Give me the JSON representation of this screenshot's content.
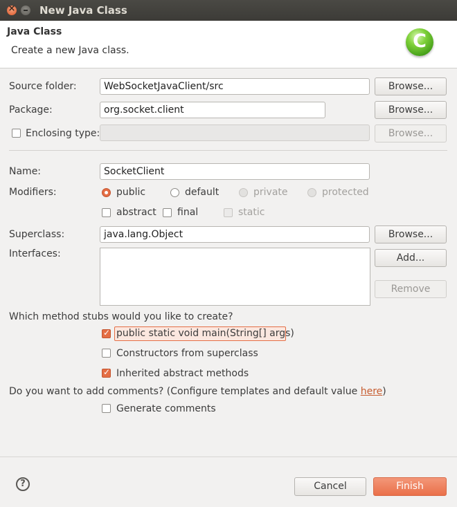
{
  "window": {
    "title": "New Java Class"
  },
  "header": {
    "title": "Java Class",
    "description": "Create a new Java class.",
    "logo_icon": "java-class-c-icon",
    "logo_letter": "C"
  },
  "form": {
    "source_folder": {
      "label": "Source folder:",
      "value": "WebSocketJavaClient/src",
      "browse": "Browse..."
    },
    "package": {
      "label": "Package:",
      "value": "org.socket.client",
      "browse": "Browse..."
    },
    "enclosing_type": {
      "label": "Enclosing type:",
      "value": "",
      "browse": "Browse...",
      "checked": false
    },
    "name": {
      "label": "Name:",
      "value": "SocketClient"
    },
    "modifiers": {
      "label": "Modifiers:",
      "access": [
        {
          "label": "public",
          "checked": true,
          "enabled": true
        },
        {
          "label": "default",
          "checked": false,
          "enabled": true
        },
        {
          "label": "private",
          "checked": false,
          "enabled": false
        },
        {
          "label": "protected",
          "checked": false,
          "enabled": false
        }
      ],
      "flags": [
        {
          "label": "abstract",
          "checked": false,
          "enabled": true
        },
        {
          "label": "final",
          "checked": false,
          "enabled": true
        },
        {
          "label": "static",
          "checked": false,
          "enabled": false
        }
      ]
    },
    "superclass": {
      "label": "Superclass:",
      "value": "java.lang.Object",
      "browse": "Browse..."
    },
    "interfaces": {
      "label": "Interfaces:",
      "add": "Add...",
      "remove": "Remove"
    },
    "stubs": {
      "question": "Which method stubs would you like to create?",
      "options": [
        {
          "label": "public static void main(String[] args)",
          "checked": true
        },
        {
          "label": "Constructors from superclass",
          "checked": false
        },
        {
          "label": "Inherited abstract methods",
          "checked": true
        }
      ]
    },
    "comments": {
      "question_prefix": "Do you want to add comments? (Configure templates and default value ",
      "link": "here",
      "question_suffix": ")",
      "option": "Generate comments",
      "checked": false
    }
  },
  "footer": {
    "help_icon": "help-icon",
    "help_glyph": "?",
    "cancel": "Cancel",
    "finish": "Finish"
  },
  "colors": {
    "accent": "#e46e45",
    "titlebar": "#3c3b37",
    "background": "#f2f1f0"
  }
}
